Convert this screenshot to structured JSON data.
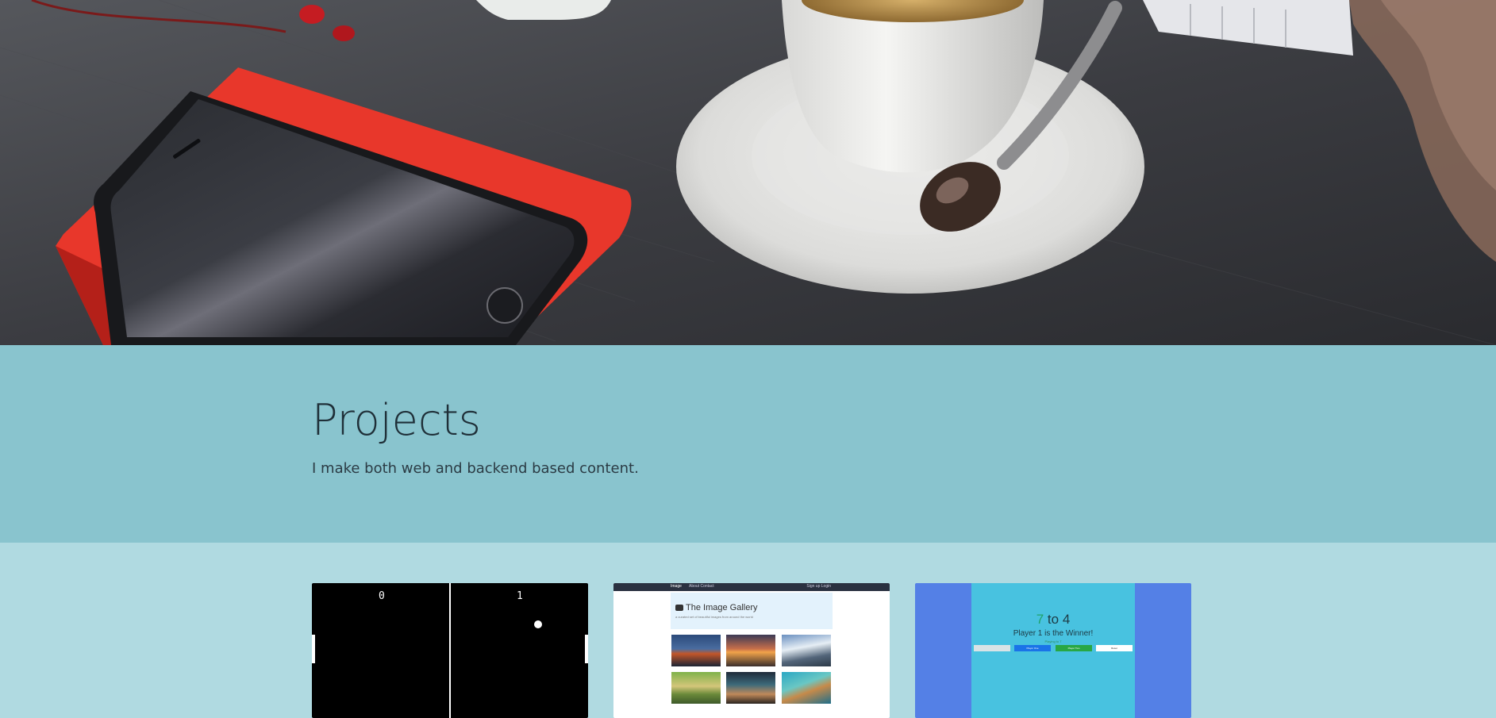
{
  "projects": {
    "title": "Projects",
    "subtitle": "I make both web and backend based content."
  },
  "cards": {
    "pong": {
      "score_left": "0",
      "score_right": "1"
    },
    "gallery": {
      "brand": "Image",
      "nav_left": "About   Contact",
      "nav_right": "Sign up   Login",
      "title": "The Image Gallery",
      "subtitle": "a curated set of beautiful images from around the world"
    },
    "scoreboard": {
      "score_a": "7",
      "score_sep": " to ",
      "score_b": "4",
      "winner_text": "Player 1 is the Winner!",
      "small_text": "Playing to 7",
      "btn_p1": "Player One",
      "btn_p2": "Player Two",
      "btn_reset": "Reset"
    }
  },
  "colors": {
    "band": "#89c4ce",
    "page_bg": "#b0dae1",
    "phone_case": "#e8372b",
    "score_bg": "#5480e6",
    "score_center": "#48c2e0"
  }
}
